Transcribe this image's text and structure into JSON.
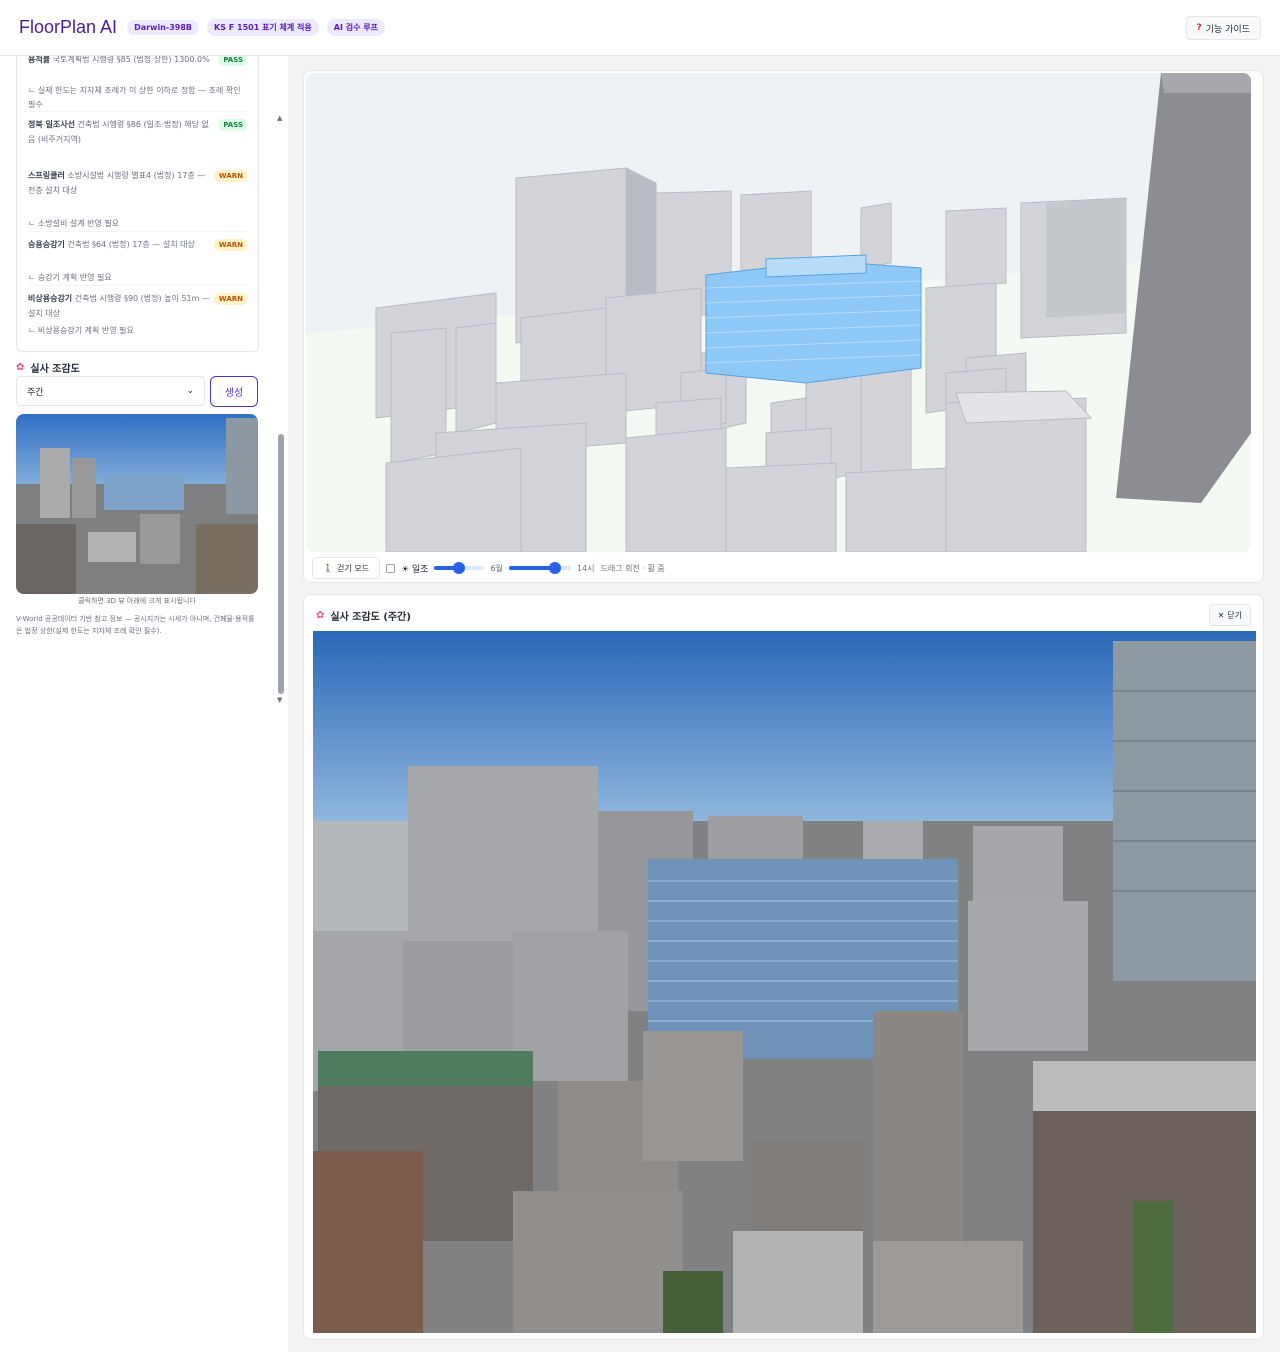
{
  "header": {
    "brand": "FloorPlan AI",
    "badges": [
      "Darwin-398B",
      "KS F 1501 표기 체계 적용",
      "AI 검수 루프"
    ],
    "guide": "기능 가이드"
  },
  "rules": [
    {
      "name": "용적률",
      "body": "국토계획법 시행령 §85 (법정 상한)",
      "value": "1300.0%",
      "status": "PASS",
      "note": "ㄴ 실제 한도는 지자체 조례가 이 상한 이하로 정함 — 조례 확인 필수"
    },
    {
      "name": "정북 일조사선",
      "body": "건축법 시행령 §86 (일조·법정)",
      "value": "해당 없음 (비주거지역)",
      "status": "PASS",
      "note": ""
    },
    {
      "name": "스프링클러",
      "body": "소방시설법 시행령 별표4 (법정)",
      "value": "17층 — 전층 설치 대상",
      "status": "WARN",
      "note": "ㄴ 소방설비 설계 반영 필요"
    },
    {
      "name": "승용승강기",
      "body": "건축법 §64 (법정)",
      "value": "17층 — 설치 대상",
      "status": "WARN",
      "note": "ㄴ 승강기 계획 반영 필요"
    },
    {
      "name": "비상용승강기",
      "body": "건축법 시행령 §90 (법정)",
      "value": "높이 51m — 설치 대상",
      "status": "WARN",
      "note": "ㄴ 비상용승강기 계획 반영 필요"
    }
  ],
  "aerial": {
    "title": "실사 조감도",
    "select_value": "주간",
    "generate": "생성",
    "caption": "클릭하면 3D 뷰 아래에 크게 표시됩니다",
    "source": "V-World 공공데이터 기반 참고 정보 — 공시지가는 시세가 아니며, 건폐율·용적률은 법정 상한(실제 한도는 지자체 조례 확인 필수)."
  },
  "controls": {
    "walk": "걷기 모드",
    "sun": "☀ 일조",
    "month": 0.5,
    "month_label": "6월",
    "hour": 0.75,
    "hour_label": "14시",
    "hint": "드래그 회전 · 휠 줌"
  },
  "panel": {
    "title": "실사 조감도 (주간)",
    "close": "닫기"
  },
  "colors": {
    "accent": "#4338ca",
    "highlight": "#8ec8f6"
  }
}
